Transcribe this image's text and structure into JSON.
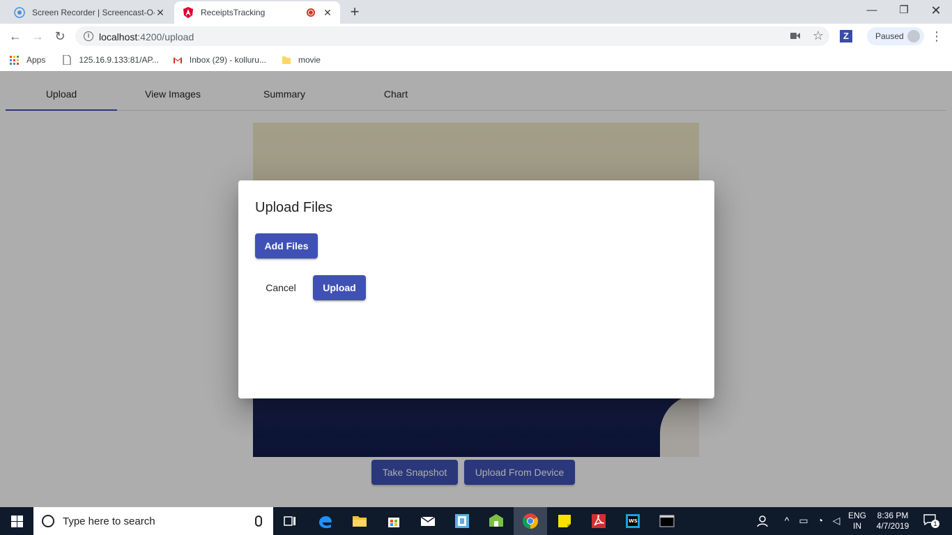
{
  "browser": {
    "tabs": [
      {
        "title": "Screen Recorder | Screencast-O-M",
        "active": false
      },
      {
        "title": "ReceiptsTracking",
        "active": true
      }
    ],
    "url_host": "localhost",
    "url_path": ":4200/upload",
    "profile_status": "Paused",
    "bookmarks": [
      {
        "label": "Apps",
        "icon": "apps-grid-icon"
      },
      {
        "label": "125.16.9.133:81/AP...",
        "icon": "page-icon"
      },
      {
        "label": "Inbox (29) - kolluru...",
        "icon": "gmail-icon"
      },
      {
        "label": "movie",
        "icon": "folder-icon"
      }
    ]
  },
  "app": {
    "nav_tabs": [
      "Upload",
      "View Images",
      "Summary",
      "Chart"
    ],
    "active_tab": "Upload",
    "buttons": {
      "take_snapshot": "Take Snapshot",
      "upload_from_device": "Upload From Device"
    },
    "accent_color": "#3f51b5"
  },
  "dialog": {
    "title": "Upload Files",
    "add_files": "Add Files",
    "cancel": "Cancel",
    "upload": "Upload"
  },
  "taskbar": {
    "search_placeholder": "Type here to search",
    "language": "ENG",
    "region": "IN",
    "time": "8:36 PM",
    "date": "4/7/2019",
    "notification_count": "1"
  }
}
